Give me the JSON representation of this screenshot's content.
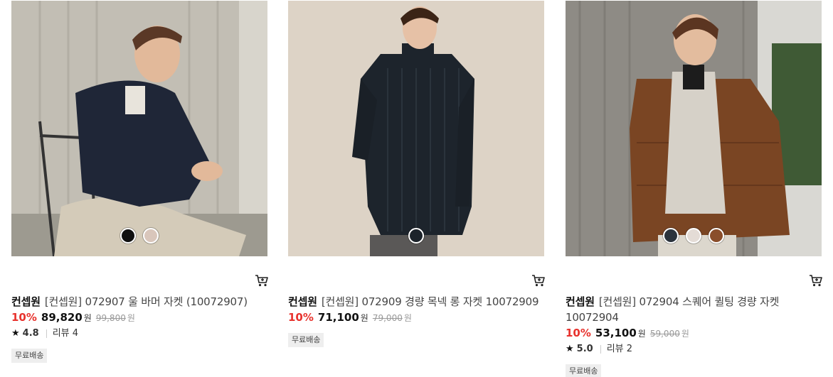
{
  "products": [
    {
      "brand": "컨셉원",
      "name": "[컨셉원] 072907 울 바머 자켓 (10072907)",
      "discount": "10%",
      "sale_price": "89,820",
      "currency": "원",
      "original_price": "99,800",
      "rating": "4.8",
      "review_label": "리뷰 4",
      "badge": "무료배송",
      "swatches": [
        "#101010",
        "#d9c6bb"
      ],
      "image_alt": "Model in navy wool bomber jacket seated on chair"
    },
    {
      "brand": "컨셉원",
      "name": "[컨셉원] 072909 경량 목넥 롱 자켓 10072909",
      "discount": "10%",
      "sale_price": "71,100",
      "currency": "원",
      "original_price": "79,000",
      "rating": null,
      "review_label": null,
      "badge": "무료배송",
      "swatches": [
        "#1c232a"
      ],
      "image_alt": "Model in long quilted mock-neck jacket"
    },
    {
      "brand": "컨셉원",
      "name": "[컨셉원] 072904 스퀘어 퀼팅 경량 자켓 10072904",
      "discount": "10%",
      "sale_price": "53,100",
      "currency": "원",
      "original_price": "59,000",
      "rating": "5.0",
      "review_label": "리뷰 2",
      "badge": "무료배송",
      "swatches": [
        "#2b333c",
        "#e4dcd6",
        "#8a4e2b"
      ],
      "image_alt": "Model in brown square-quilted light jacket"
    }
  ]
}
